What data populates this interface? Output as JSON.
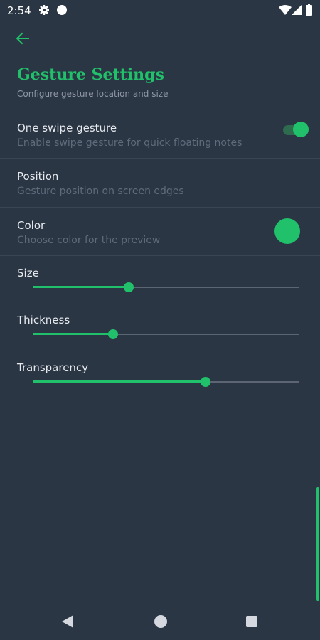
{
  "status_bar": {
    "time": "2:54",
    "icons": [
      "gear-icon",
      "circle-icon",
      "wifi-icon",
      "signal-icon",
      "battery-icon"
    ]
  },
  "header": {
    "back_icon": "arrow-left-icon",
    "title": "Gesture Settings",
    "subtitle": "Configure gesture location and size"
  },
  "settings": {
    "swipe": {
      "title": "One swipe gesture",
      "subtitle": "Enable swipe gesture for quick floating notes",
      "enabled": true
    },
    "position": {
      "title": "Position",
      "subtitle": "Gesture position on screen edges"
    },
    "color": {
      "title": "Color",
      "subtitle": "Choose color for the preview",
      "value": "#21c06a"
    }
  },
  "sliders": [
    {
      "label": "Size",
      "fraction": 0.36
    },
    {
      "label": "Thickness",
      "fraction": 0.3
    },
    {
      "label": "Transparency",
      "fraction": 0.65
    }
  ],
  "colors": {
    "accent": "#21c06a",
    "background": "#2b3644"
  },
  "nav_bar": {
    "icons": [
      "back-triangle-icon",
      "home-circle-icon",
      "recents-square-icon"
    ]
  }
}
